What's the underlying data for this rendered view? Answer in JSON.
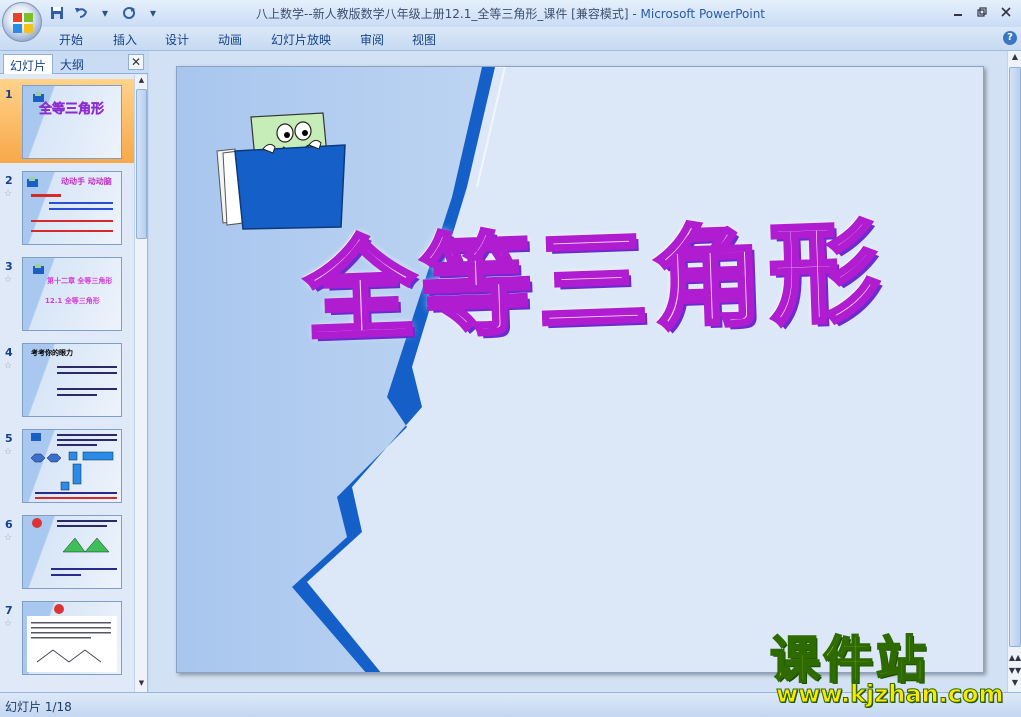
{
  "window": {
    "title": "八上数学--新人教版数学八年级上册12.1_全等三角形_课件 [兼容模式]",
    "separator": " - ",
    "app_name": "Microsoft PowerPoint"
  },
  "quick_access": {
    "dropdown_glyph": "▾"
  },
  "ribbon": {
    "tabs": [
      "开始",
      "插入",
      "设计",
      "动画",
      "幻灯片放映",
      "审阅",
      "视图"
    ]
  },
  "slide_pane": {
    "tabs": {
      "slides": "幻灯片",
      "outline": "大纲"
    },
    "close_glyph": "✕",
    "thumbnails": [
      {
        "number": "1",
        "title": "全等三角形"
      },
      {
        "number": "2",
        "title": "动动手 动动脑"
      },
      {
        "number": "3",
        "title": "第十二章 全等三角形",
        "sub": "12.1 全等三角形"
      },
      {
        "number": "4",
        "title": "考考你的眼力"
      },
      {
        "number": "5",
        "title": ""
      },
      {
        "number": "6",
        "title": ""
      },
      {
        "number": "7",
        "title": ""
      }
    ]
  },
  "slide": {
    "title": "全等三角形"
  },
  "status_bar": {
    "slide_counter": "幻灯片 1/18"
  },
  "watermark": {
    "brand": "课件站",
    "url": "www.kjzhan.com"
  },
  "colors": {
    "title_fill": "#f3d6f7",
    "title_stroke": "#b01cd0",
    "accent_blue": "#1560c8",
    "watermark_yellow": "#ffe800"
  }
}
